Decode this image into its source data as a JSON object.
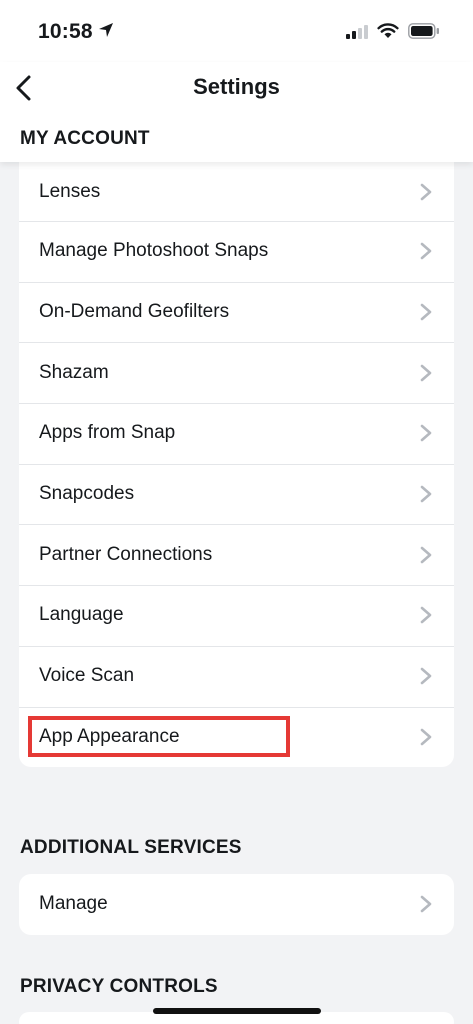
{
  "status_bar": {
    "time": "10:58",
    "icons": [
      "location-arrow-icon",
      "cellular-signal-icon",
      "wifi-icon",
      "battery-icon"
    ]
  },
  "header": {
    "title": "Settings",
    "back_icon": "chevron-left-icon"
  },
  "sections": {
    "my_account": {
      "label": "MY ACCOUNT",
      "items": [
        {
          "label": "Lenses"
        },
        {
          "label": "Manage Photoshoot Snaps"
        },
        {
          "label": "On-Demand Geofilters"
        },
        {
          "label": "Shazam"
        },
        {
          "label": "Apps from Snap"
        },
        {
          "label": "Snapcodes"
        },
        {
          "label": "Partner Connections"
        },
        {
          "label": "Language"
        },
        {
          "label": "Voice Scan"
        },
        {
          "label": "App Appearance",
          "highlighted": true
        }
      ]
    },
    "additional_services": {
      "label": "ADDITIONAL SERVICES",
      "items": [
        {
          "label": "Manage"
        }
      ]
    },
    "privacy_controls": {
      "label": "PRIVACY CONTROLS"
    }
  },
  "colors": {
    "background": "#f2f3f5",
    "card": "#ffffff",
    "text": "#16191c",
    "chevron": "#b5b9bf",
    "highlight_border": "#e53935"
  }
}
